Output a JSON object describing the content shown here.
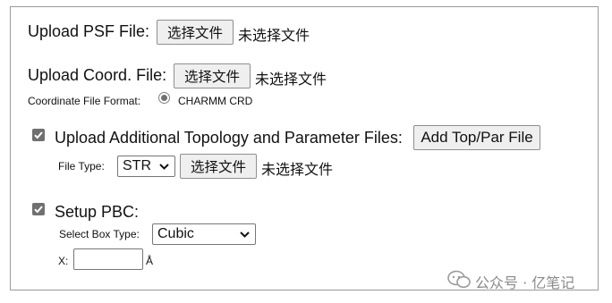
{
  "psf": {
    "label": "Upload PSF File:",
    "button": "选择文件",
    "status": "未选择文件"
  },
  "coord": {
    "label": "Upload Coord. File:",
    "button": "选择文件",
    "status": "未选择文件",
    "format_label": "Coordinate File Format:",
    "format_option": "CHARMM CRD"
  },
  "topology": {
    "checked": true,
    "label": "Upload Additional Topology and Parameter Files:",
    "add_button": "Add Top/Par File",
    "file_type_label": "File Type:",
    "file_type_value": "STR",
    "button": "选择文件",
    "status": "未选择文件"
  },
  "pbc": {
    "checked": true,
    "label": "Setup PBC:",
    "box_type_label": "Select Box Type:",
    "box_type_value": "Cubic",
    "x_label": "X:",
    "x_value": "",
    "unit": "Å"
  },
  "watermark": {
    "icon": "wechat-icon",
    "text": "公众号 · 亿笔记"
  }
}
